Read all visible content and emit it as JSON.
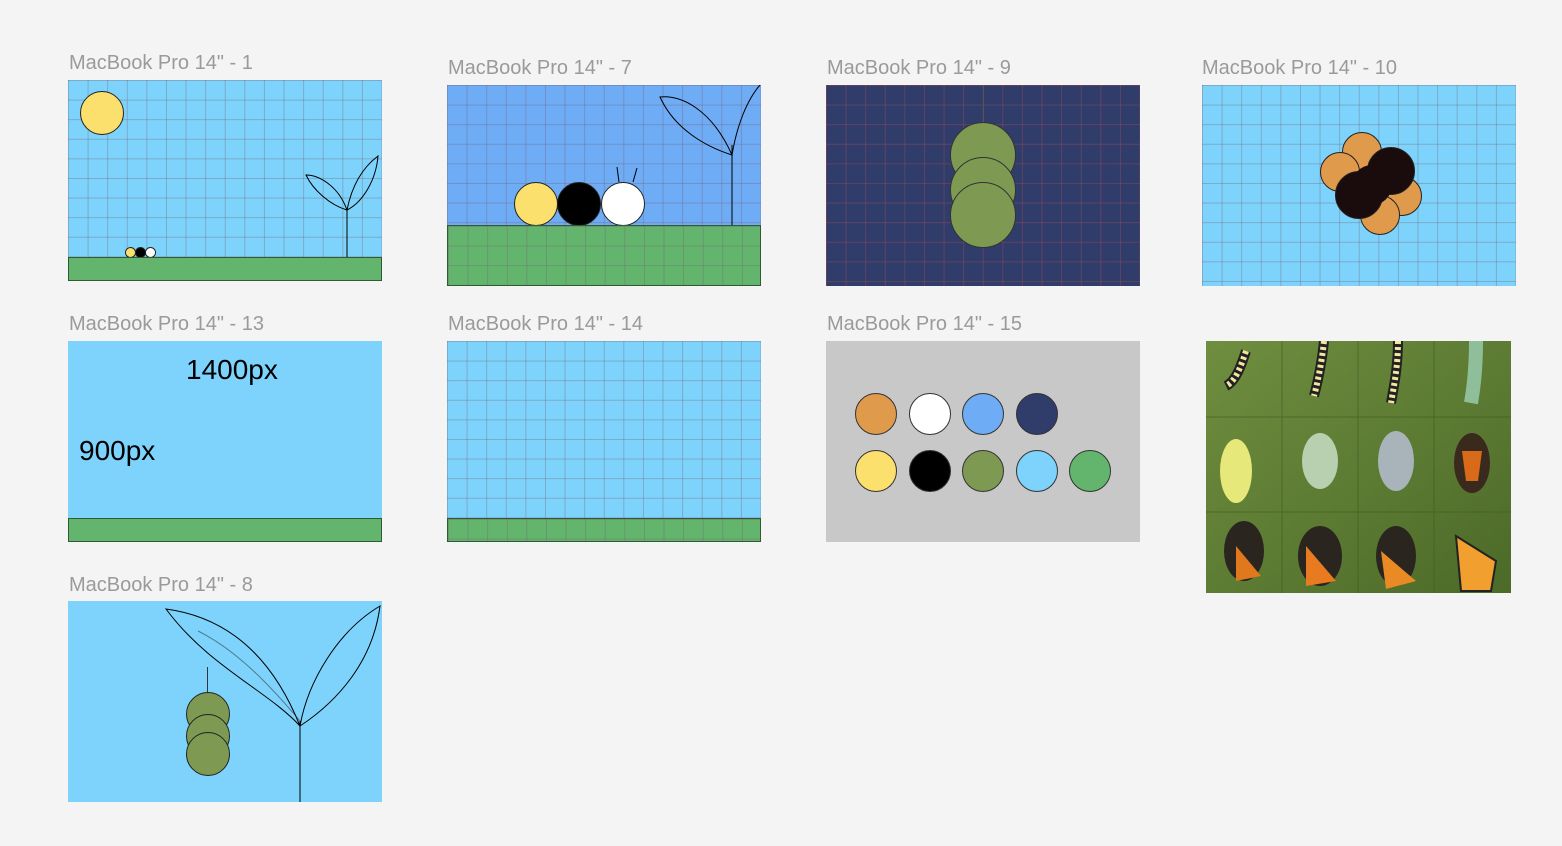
{
  "frames": {
    "f1": {
      "label": "MacBook Pro 14\" - 1"
    },
    "f7": {
      "label": "MacBook Pro 14\" - 7"
    },
    "f9": {
      "label": "MacBook Pro 14\" - 9"
    },
    "f10": {
      "label": "MacBook Pro 14\" - 10"
    },
    "f13": {
      "label": "MacBook Pro 14\" - 13",
      "width_text": "1400px",
      "height_text": "900px"
    },
    "f14": {
      "label": "MacBook Pro 14\" - 14"
    },
    "f15": {
      "label": "MacBook Pro 14\" - 15"
    },
    "f8": {
      "label": "MacBook Pro 14\" - 8"
    },
    "photo": {
      "alt": "Monarch butterfly metamorphosis photo grid"
    }
  },
  "colors": {
    "sky": "#7dd3fb",
    "sky_blue": "#6eacf5",
    "navy": "#303c6a",
    "ground": "#63b56e",
    "sun": "#fbe06e",
    "black": "#000000",
    "white": "#ffffff",
    "olive": "#7e9a52",
    "orange": "#e09a4b",
    "light_gray": "#c8c8c8"
  },
  "palette_swatches": [
    {
      "name": "orange",
      "hex": "#e09a4b"
    },
    {
      "name": "white",
      "hex": "#ffffff"
    },
    {
      "name": "sky-blue",
      "hex": "#6eacf5"
    },
    {
      "name": "navy",
      "hex": "#303c6a"
    },
    {
      "name": "sun-yellow",
      "hex": "#fbe06e"
    },
    {
      "name": "black",
      "hex": "#000000"
    },
    {
      "name": "olive",
      "hex": "#7e9a52"
    },
    {
      "name": "light-sky",
      "hex": "#7dd3fb"
    },
    {
      "name": "grass-green",
      "hex": "#63b56e"
    }
  ]
}
